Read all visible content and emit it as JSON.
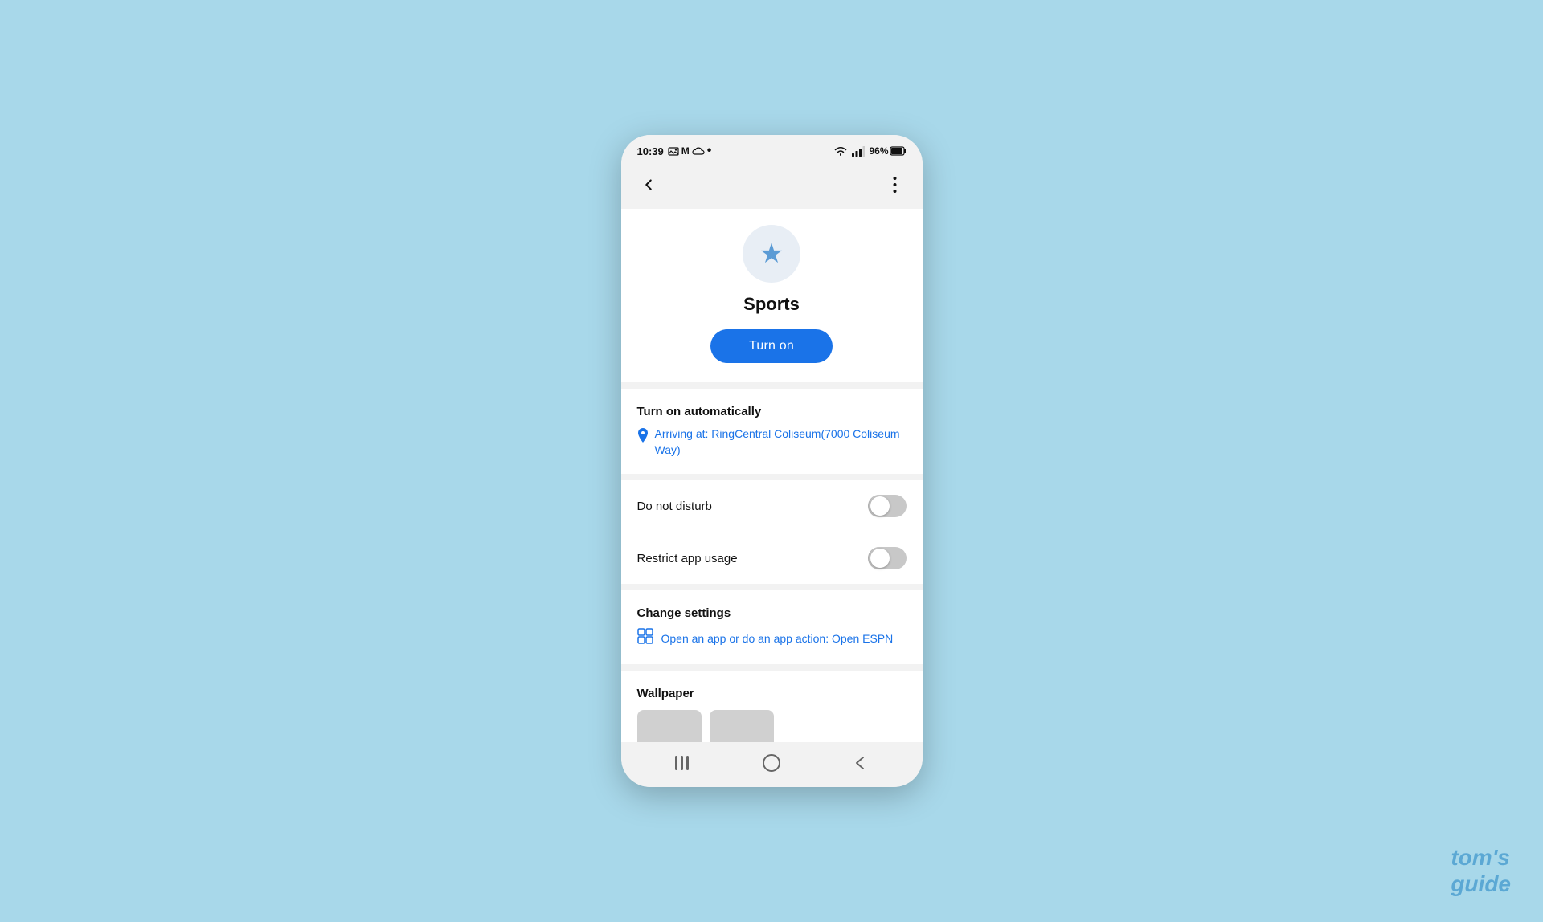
{
  "status_bar": {
    "time": "10:39",
    "battery": "96%"
  },
  "hero": {
    "mode_name": "Sports",
    "turn_on_label": "Turn on",
    "icon": "★"
  },
  "turn_on_automatically": {
    "section_label": "Turn on automatically",
    "location_text": "Arriving at: RingCentral Coliseum(7000 Coliseum Way)"
  },
  "toggles": {
    "do_not_disturb_label": "Do not disturb",
    "restrict_app_usage_label": "Restrict app usage"
  },
  "change_settings": {
    "section_label": "Change settings",
    "action_text": "Open an app or do an app action: Open ESPN"
  },
  "wallpaper": {
    "section_label": "Wallpaper"
  },
  "watermark": {
    "line1": "tom's",
    "line2": "guide"
  }
}
